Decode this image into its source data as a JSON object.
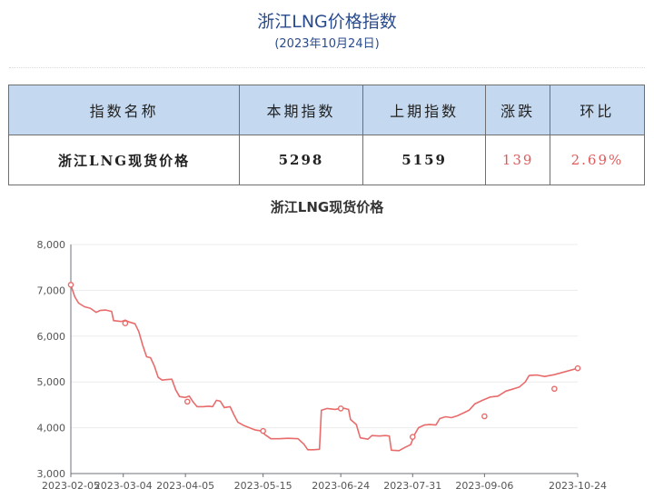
{
  "page": {
    "title": "浙江LNG价格指数",
    "date": "(2023年10月24日)"
  },
  "table": {
    "headers": [
      "指数名称",
      "本期指数",
      "上期指数",
      "涨跌",
      "环比"
    ],
    "row": {
      "name": "浙江LNG现货价格",
      "current": "5298",
      "previous": "5159",
      "change": "139",
      "ratio": "2.69%"
    }
  },
  "colors": {
    "line": "#e86c6c",
    "header_bg": "#c4d9f0",
    "up": "#e05a5a",
    "title": "#2a4b8d"
  },
  "chart_data": {
    "type": "line",
    "title": "浙江LNG现货价格",
    "xlabel": "",
    "ylabel": "",
    "ylim": [
      3000,
      8000
    ],
    "yticks": [
      3000,
      4000,
      5000,
      6000,
      7000,
      8000
    ],
    "ytick_labels": [
      "3,000",
      "4,000",
      "5,000",
      "6,000",
      "7,000",
      "8,000"
    ],
    "xticks": [
      "2023-02-05",
      "2023-03-04",
      "2023-04-05",
      "2023-05-15",
      "2023-06-24",
      "2023-07-31",
      "2023-09-06",
      "2023-10-24"
    ],
    "grid": true,
    "series": [
      {
        "values": [
          [
            "2023-02-05",
            7120
          ],
          [
            "2023-02-06",
            6990
          ],
          [
            "2023-02-07",
            6860
          ],
          [
            "2023-02-09",
            6720
          ],
          [
            "2023-02-12",
            6640
          ],
          [
            "2023-02-15",
            6610
          ],
          [
            "2023-02-18",
            6520
          ],
          [
            "2023-02-20",
            6560
          ],
          [
            "2023-02-23",
            6570
          ],
          [
            "2023-02-26",
            6540
          ],
          [
            "2023-02-27",
            6340
          ],
          [
            "2023-03-01",
            6330
          ],
          [
            "2023-03-03",
            6320
          ],
          [
            "2023-03-05",
            6350
          ],
          [
            "2023-03-07",
            6310
          ],
          [
            "2023-03-10",
            6270
          ],
          [
            "2023-03-12",
            6100
          ],
          [
            "2023-03-14",
            5800
          ],
          [
            "2023-03-16",
            5550
          ],
          [
            "2023-03-18",
            5530
          ],
          [
            "2023-03-20",
            5350
          ],
          [
            "2023-03-22",
            5100
          ],
          [
            "2023-03-24",
            5040
          ],
          [
            "2023-03-26",
            5050
          ],
          [
            "2023-03-29",
            5060
          ],
          [
            "2023-03-31",
            4830
          ],
          [
            "2023-04-02",
            4680
          ],
          [
            "2023-04-05",
            4660
          ],
          [
            "2023-04-07",
            4690
          ],
          [
            "2023-04-09",
            4560
          ],
          [
            "2023-04-11",
            4460
          ],
          [
            "2023-04-14",
            4460
          ],
          [
            "2023-04-17",
            4470
          ],
          [
            "2023-04-19",
            4460
          ],
          [
            "2023-04-21",
            4600
          ],
          [
            "2023-04-23",
            4580
          ],
          [
            "2023-04-25",
            4440
          ],
          [
            "2023-04-28",
            4460
          ],
          [
            "2023-04-30",
            4280
          ],
          [
            "2023-05-02",
            4120
          ],
          [
            "2023-05-05",
            4050
          ],
          [
            "2023-05-08",
            4000
          ],
          [
            "2023-05-11",
            3950
          ],
          [
            "2023-05-14",
            3930
          ],
          [
            "2023-05-16",
            3850
          ],
          [
            "2023-05-19",
            3760
          ],
          [
            "2023-05-23",
            3760
          ],
          [
            "2023-05-28",
            3770
          ],
          [
            "2023-06-02",
            3760
          ],
          [
            "2023-06-05",
            3640
          ],
          [
            "2023-06-07",
            3520
          ],
          [
            "2023-06-10",
            3520
          ],
          [
            "2023-06-13",
            3530
          ],
          [
            "2023-06-14",
            4380
          ],
          [
            "2023-06-17",
            4420
          ],
          [
            "2023-06-21",
            4400
          ],
          [
            "2023-06-25",
            4430
          ],
          [
            "2023-06-28",
            4400
          ],
          [
            "2023-06-29",
            4180
          ],
          [
            "2023-07-02",
            4070
          ],
          [
            "2023-07-04",
            3780
          ],
          [
            "2023-07-08",
            3750
          ],
          [
            "2023-07-10",
            3830
          ],
          [
            "2023-07-14",
            3820
          ],
          [
            "2023-07-17",
            3830
          ],
          [
            "2023-07-19",
            3820
          ],
          [
            "2023-07-20",
            3510
          ],
          [
            "2023-07-24",
            3500
          ],
          [
            "2023-07-27",
            3570
          ],
          [
            "2023-07-30",
            3630
          ],
          [
            "2023-08-01",
            3850
          ],
          [
            "2023-08-03",
            4000
          ],
          [
            "2023-08-06",
            4060
          ],
          [
            "2023-08-09",
            4070
          ],
          [
            "2023-08-12",
            4060
          ],
          [
            "2023-08-14",
            4200
          ],
          [
            "2023-08-17",
            4240
          ],
          [
            "2023-08-20",
            4220
          ],
          [
            "2023-08-23",
            4260
          ],
          [
            "2023-08-26",
            4320
          ],
          [
            "2023-08-29",
            4380
          ],
          [
            "2023-09-01",
            4520
          ],
          [
            "2023-09-05",
            4600
          ],
          [
            "2023-09-09",
            4670
          ],
          [
            "2023-09-13",
            4690
          ],
          [
            "2023-09-17",
            4800
          ],
          [
            "2023-09-21",
            4850
          ],
          [
            "2023-09-24",
            4890
          ],
          [
            "2023-09-27",
            5000
          ],
          [
            "2023-09-29",
            5140
          ],
          [
            "2023-10-03",
            5150
          ],
          [
            "2023-10-07",
            5120
          ],
          [
            "2023-10-12",
            5159
          ],
          [
            "2023-10-24",
            5298
          ]
        ],
        "markers": [
          [
            "2023-02-05",
            7120
          ],
          [
            "2023-03-05",
            6280
          ],
          [
            "2023-04-06",
            4570
          ],
          [
            "2023-05-15",
            3930
          ],
          [
            "2023-06-24",
            4420
          ],
          [
            "2023-07-31",
            3800
          ],
          [
            "2023-09-06",
            4250
          ],
          [
            "2023-10-12",
            4850
          ],
          [
            "2023-10-24",
            5298
          ]
        ]
      }
    ]
  }
}
